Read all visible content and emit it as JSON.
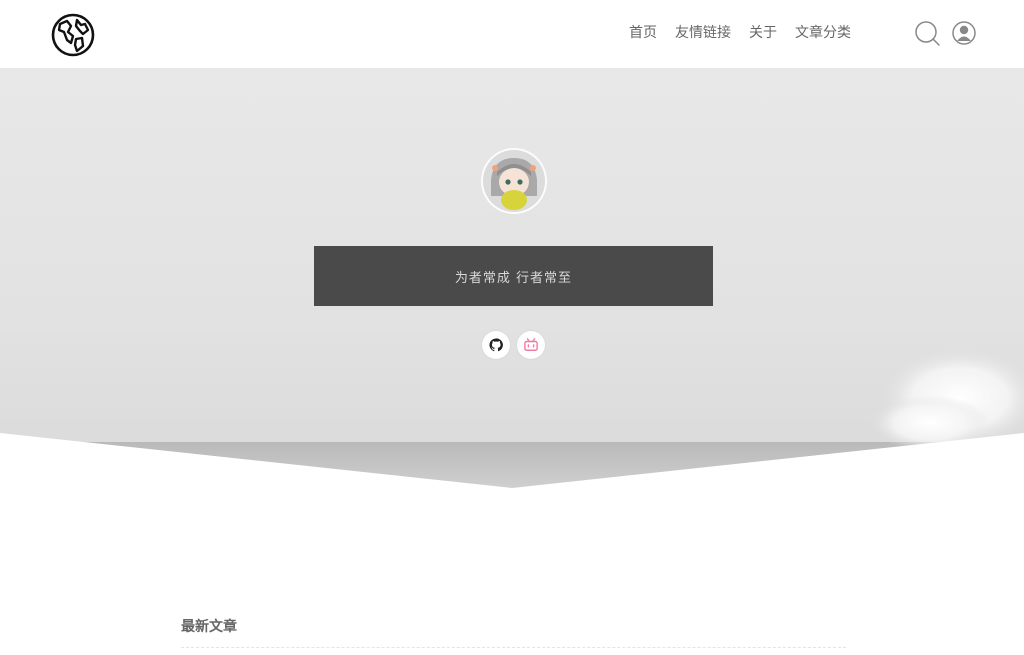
{
  "header": {
    "logo_icon": "globe-icon",
    "nav": [
      {
        "label": "首页"
      },
      {
        "label": "友情链接"
      },
      {
        "label": "关于"
      },
      {
        "label": "文章分类"
      }
    ],
    "search_icon": "search-icon",
    "user_icon": "user-icon"
  },
  "hero": {
    "avatar_icon": "avatar-image",
    "motto": "为者常成 行者常至",
    "social": [
      {
        "icon": "github-icon"
      },
      {
        "icon": "bilibili-icon",
        "color": "#f07ba5"
      }
    ]
  },
  "main": {
    "section_title": "最新文章"
  },
  "colors": {
    "motto_bg": "#4a4a4a",
    "nav_text": "#666666",
    "hero_bg": "#e6e6e6"
  }
}
